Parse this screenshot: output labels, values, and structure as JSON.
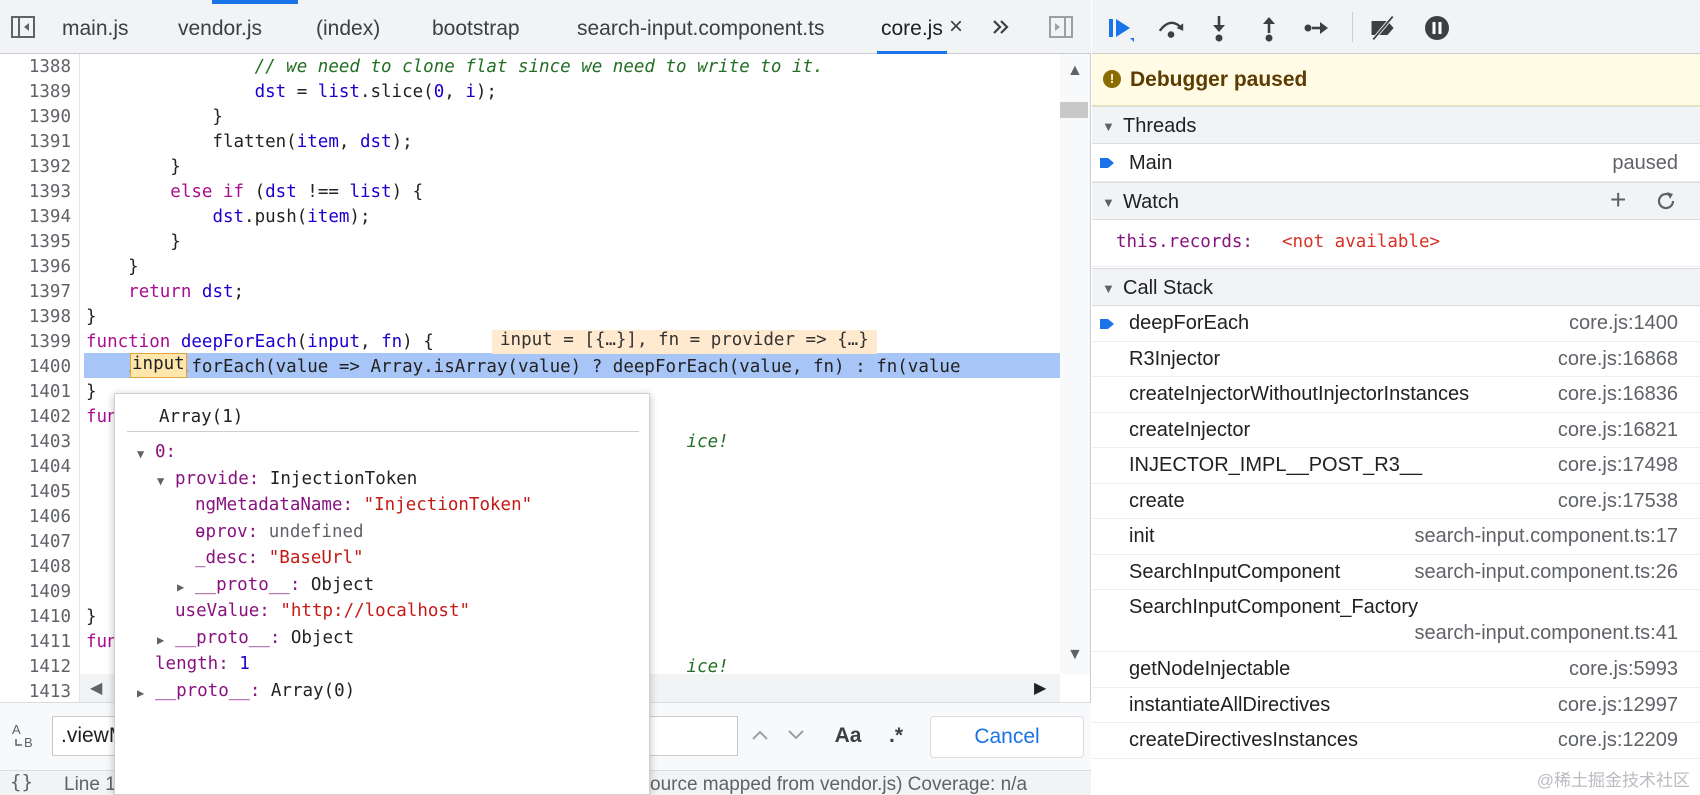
{
  "tabs": [
    {
      "label": "main.js"
    },
    {
      "label": "vendor.js"
    },
    {
      "label": "(index)"
    },
    {
      "label": "bootstrap"
    },
    {
      "label": "search-input.component.ts"
    },
    {
      "label": "core.js",
      "active": true
    }
  ],
  "tab_overflow_icon": "double-chevron-right-icon",
  "code_lines": [
    {
      "n": "1388",
      "html": "                <span class='cm'>// we need to clone flat since we need to write to it.</span>"
    },
    {
      "n": "1389",
      "html": "                <span class='id'>dst</span> = <span class='id'>list</span>.slice(<span class='num'>0</span>, <span class='id'>i</span>);"
    },
    {
      "n": "1390",
      "html": "            }"
    },
    {
      "n": "1391",
      "html": "            flatten(<span class='id'>item</span>, <span class='id'>dst</span>);"
    },
    {
      "n": "1392",
      "html": "        }"
    },
    {
      "n": "1393",
      "html": "        <span class='kw'>else if</span> (<span class='id'>dst</span> !== <span class='id'>list</span>) {"
    },
    {
      "n": "1394",
      "html": "            <span class='id'>dst</span>.push(<span class='id'>item</span>);"
    },
    {
      "n": "1395",
      "html": "        }"
    },
    {
      "n": "1396",
      "html": "    }"
    },
    {
      "n": "1397",
      "html": "    <span class='kw'>return</span> <span class='id'>dst</span>;"
    },
    {
      "n": "1398",
      "html": "}"
    },
    {
      "n": "1399",
      "html": "<span class='kw'>function</span> <span class='id'>deepForEach</span>(<span class='id'>input</span>, <span class='id'>fn</span>) {"
    },
    {
      "n": "1400",
      "html": "    input.forEach(value => Array.isArray(value) ? deepForEach(value, fn) : fn(value"
    },
    {
      "n": "1401",
      "html": "}"
    },
    {
      "n": "1402",
      "html": "<span class='kw'>fun</span>"
    },
    {
      "n": "1403",
      "html": "                                                         <span class='cm'>ice!</span>"
    },
    {
      "n": "1404",
      "html": ""
    },
    {
      "n": "1405",
      "html": ""
    },
    {
      "n": "1406",
      "html": ""
    },
    {
      "n": "1407",
      "html": ""
    },
    {
      "n": "1408",
      "html": ""
    },
    {
      "n": "1409",
      "html": ""
    },
    {
      "n": "1410",
      "html": "}"
    },
    {
      "n": "1411",
      "html": "<span class='kw'>fun</span>"
    },
    {
      "n": "1412",
      "html": "                                                         <span class='cm'>ice!</span>"
    },
    {
      "n": "1413",
      "html": ""
    }
  ],
  "inline_hint": "input = [{…}], fn = provider => {…}",
  "hover_word": "input",
  "popover": {
    "title": "Array(1)",
    "lines": [
      {
        "indent": 0,
        "tri": "down",
        "key": "0:",
        "val": ""
      },
      {
        "indent": 1,
        "tri": "down",
        "key": "provide:",
        "val": " InjectionToken"
      },
      {
        "indent": 2,
        "tri": "",
        "key": "ngMetadataName:",
        "val": " \"InjectionToken\"",
        "str": true
      },
      {
        "indent": 2,
        "tri": "",
        "key": "ɵprov:",
        "val": " undefined",
        "dim": true
      },
      {
        "indent": 2,
        "tri": "",
        "key": "_desc:",
        "val": " \"BaseUrl\"",
        "str": true
      },
      {
        "indent": 2,
        "tri": "right",
        "key": "__proto__:",
        "val": " Object"
      },
      {
        "indent": 1,
        "tri": "",
        "key": "useValue:",
        "val": " \"http://localhost\"",
        "str": true
      },
      {
        "indent": 1,
        "tri": "right",
        "key": "__proto__:",
        "val": " Object"
      },
      {
        "indent": 0,
        "tri": "",
        "key": "length:",
        "val": " 1",
        "num": true
      },
      {
        "indent": 0,
        "tri": "right",
        "key": "__proto__:",
        "val": " Array(0)"
      }
    ]
  },
  "search": {
    "value": ".viewM",
    "match_case_label": "Aa",
    "regex_label": ".*",
    "cancel_label": "Cancel"
  },
  "status": {
    "line_text": "Line 1",
    "mapped_text": "ource mapped from vendor.js)  Coverage: n/a"
  },
  "debugger": {
    "paused_label": "Debugger paused",
    "threads_title": "Threads",
    "thread_name": "Main",
    "thread_state": "paused",
    "watch_title": "Watch",
    "watch_expr": "this.records:",
    "watch_value": "<not available>",
    "callstack_title": "Call Stack",
    "frames": [
      {
        "name": "deepForEach",
        "loc": "core.js:1400",
        "current": true
      },
      {
        "name": "R3Injector",
        "loc": "core.js:16868"
      },
      {
        "name": "createInjectorWithoutInjectorInstances",
        "loc": "core.js:16836"
      },
      {
        "name": "createInjector",
        "loc": "core.js:16821"
      },
      {
        "name": "INJECTOR_IMPL__POST_R3__",
        "loc": "core.js:17498"
      },
      {
        "name": "create",
        "loc": "core.js:17538"
      },
      {
        "name": "init",
        "loc": "search-input.component.ts:17"
      },
      {
        "name": "SearchInputComponent",
        "loc": "search-input.component.ts:26"
      },
      {
        "name": "SearchInputComponent_Factory",
        "loc": "search-input.component.ts:41",
        "wrap": true
      },
      {
        "name": "getNodeInjectable",
        "loc": "core.js:5993"
      },
      {
        "name": "instantiateAllDirectives",
        "loc": "core.js:12997"
      },
      {
        "name": "createDirectivesInstances",
        "loc": "core.js:12209"
      }
    ]
  },
  "watermark": "@稀土掘金技术社区",
  "colors": {
    "accent": "#1a73e8",
    "exec_line": "#a8c5f7",
    "paused_banner": "#fffbe5",
    "string": "#c41a16",
    "keyword": "#aa0d91"
  }
}
